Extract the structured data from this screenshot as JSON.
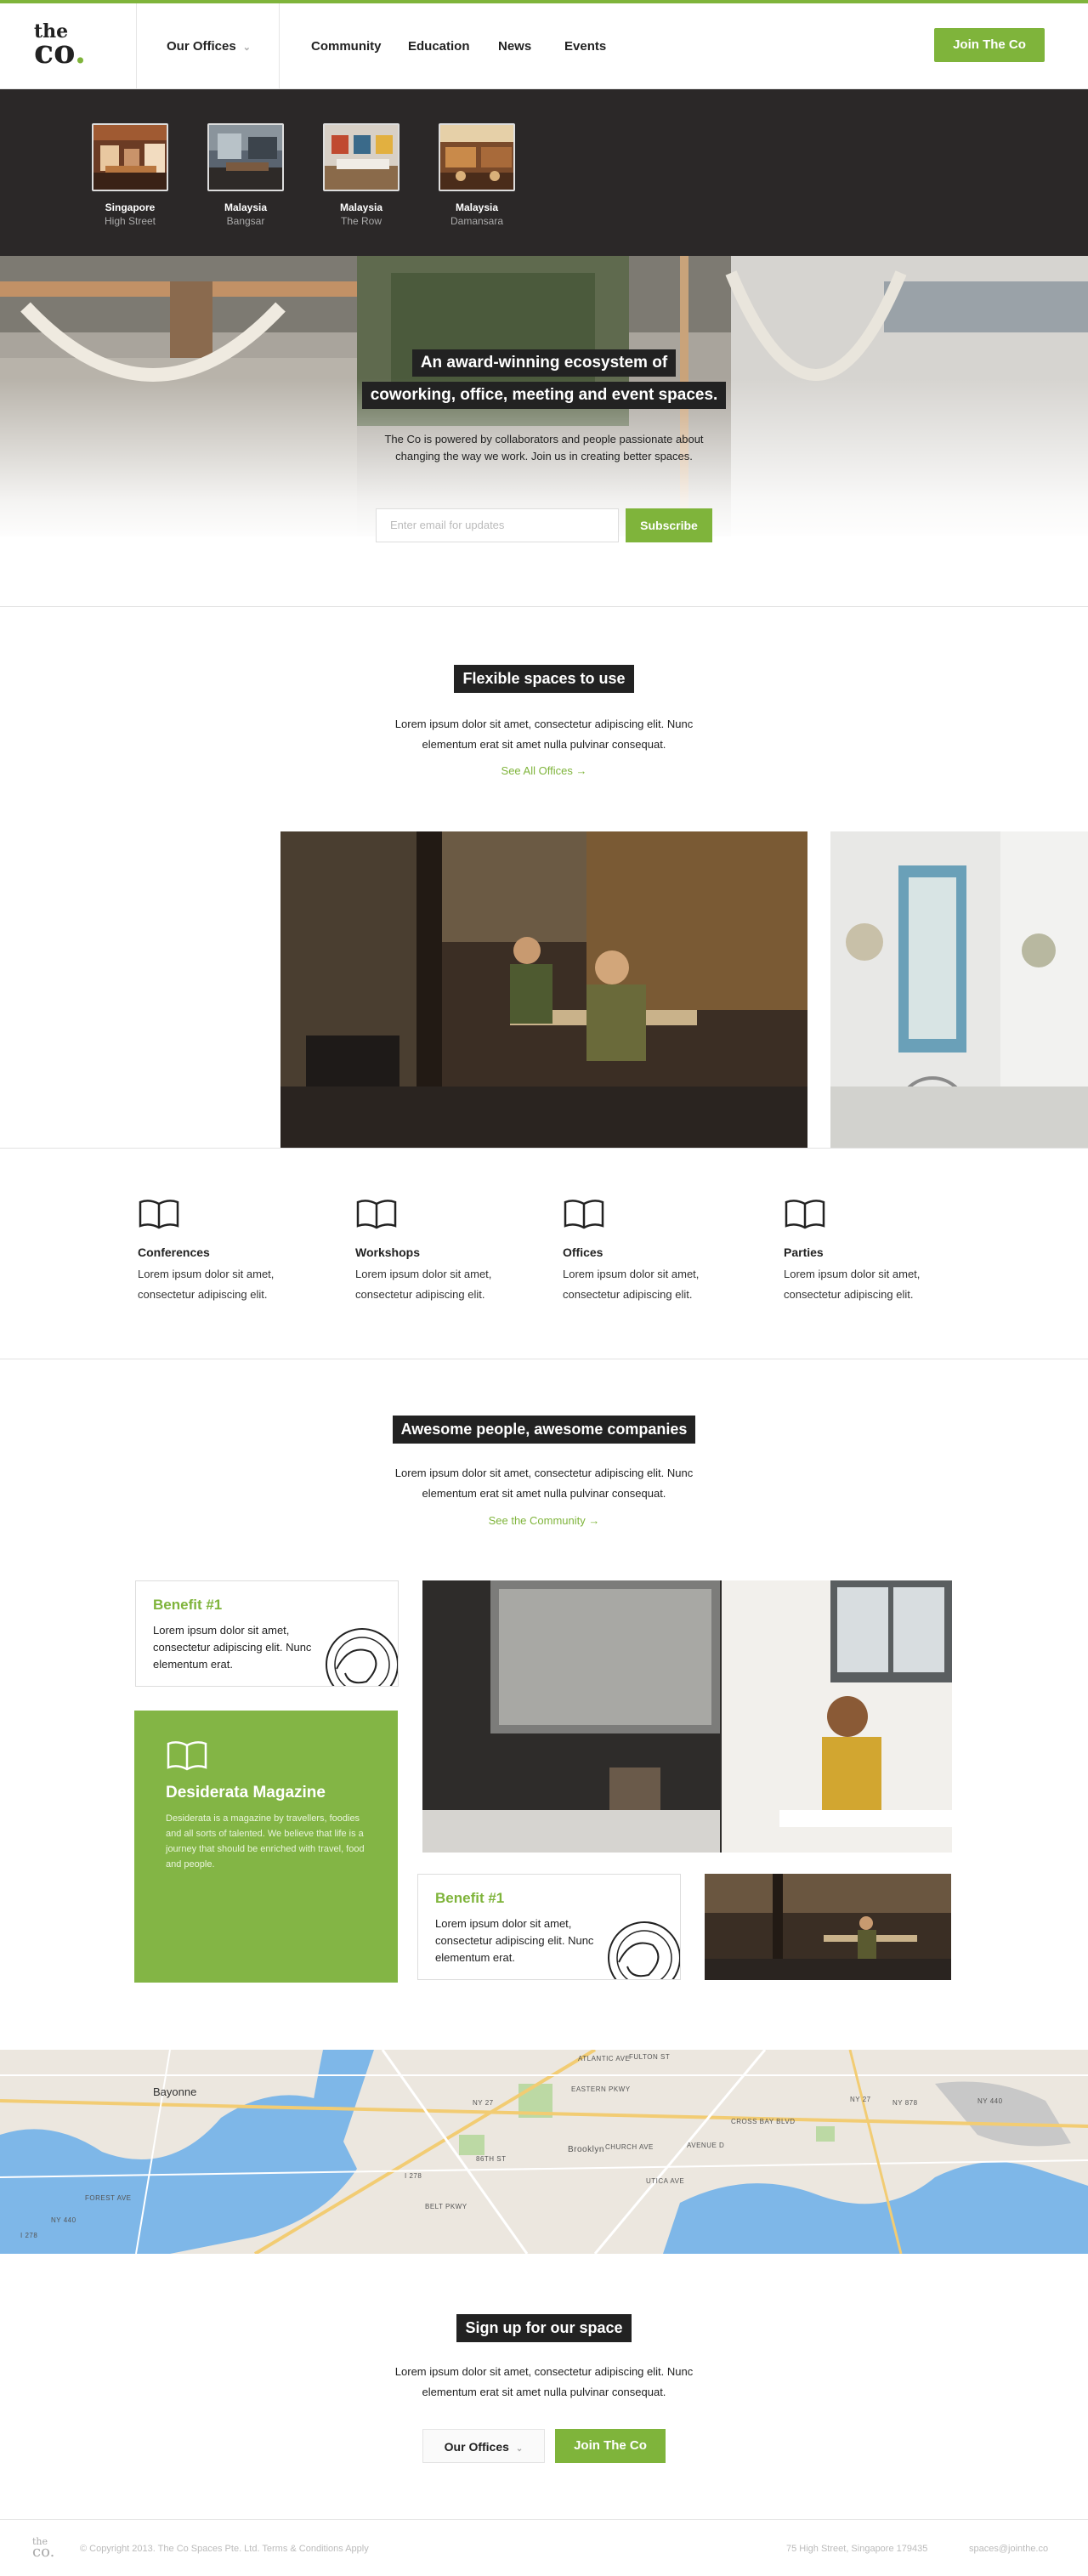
{
  "brand": {
    "logo_top": "the",
    "logo_bottom": "co",
    "accent": "#7fb43b"
  },
  "nav": {
    "offices_label": "Our Offices",
    "items": [
      "Community",
      "Education",
      "News",
      "Events"
    ],
    "join_label": "Join The Co"
  },
  "offices": [
    {
      "country": "Singapore",
      "city": "High Street"
    },
    {
      "country": "Malaysia",
      "city": "Bangsar"
    },
    {
      "country": "Malaysia",
      "city": "The Row"
    },
    {
      "country": "Malaysia",
      "city": "Damansara"
    }
  ],
  "hero": {
    "title_line1": "An award-winning ecosystem of",
    "title_line2": "coworking, office, meeting and event spaces.",
    "subtitle_line1": "The Co is powered by collaborators and people passionate about",
    "subtitle_line2": "changing the way we work. Join us in creating better spaces.",
    "email_placeholder": "Enter email for updates",
    "subscribe_label": "Subscribe"
  },
  "spaces": {
    "title": "Flexible spaces to use",
    "text_line1": "Lorem ipsum dolor sit amet, consectetur adipiscing elit. Nunc",
    "text_line2": "elementum erat sit amet nulla pulvinar consequat.",
    "link": "See All Offices"
  },
  "features": [
    {
      "name": "Conferences",
      "desc": "Lorem ipsum dolor sit amet, consectetur adipiscing elit."
    },
    {
      "name": "Workshops",
      "desc": "Lorem ipsum dolor sit amet, consectetur adipiscing elit."
    },
    {
      "name": "Offices",
      "desc": "Lorem ipsum dolor sit amet, consectetur adipiscing elit."
    },
    {
      "name": "Parties",
      "desc": "Lorem ipsum dolor sit amet, consectetur adipiscing elit."
    }
  ],
  "community": {
    "title": "Awesome people, awesome companies",
    "text_line1": "Lorem ipsum dolor sit amet, consectetur adipiscing elit. Nunc",
    "text_line2": "elementum erat sit amet nulla pulvinar consequat.",
    "link": "See the Community",
    "benefit1_title": "Benefit #1",
    "benefit1_text": "Lorem ipsum dolor sit amet, consectetur adipiscing elit. Nunc elementum erat.",
    "benefit2_title": "Benefit #1",
    "benefit2_text": "Lorem ipsum dolor sit amet, consectetur adipiscing elit. Nunc elementum erat.",
    "magazine_title": "Desiderata Magazine",
    "magazine_text": "Desiderata is a magazine by travellers, foodies and all sorts of talented. We believe that life is a journey that should be enriched with travel, food and people."
  },
  "map": {
    "labels": [
      "Bayonne",
      "ATLANTIC AVE",
      "FULTON ST",
      "EASTERN PKWY",
      "NY 27",
      "NY 27",
      "NY 878",
      "Brooklyn",
      "CHURCH AVE",
      "AVENUE D",
      "FOREST AVE",
      "NY 440",
      "I 278",
      "I 278",
      "BELT PKWY",
      "UTICA AVE",
      "CROSS BAY BLVD",
      "86TH ST",
      "NY 440"
    ]
  },
  "signup": {
    "title": "Sign up for our space",
    "text_line1": "Lorem ipsum dolor sit amet, consectetur adipiscing elit. Nunc",
    "text_line2": "elementum erat sit amet nulla pulvinar consequat.",
    "offices_label": "Our Offices",
    "join_label": "Join The Co"
  },
  "footer": {
    "logo_top": "the",
    "logo_bottom": "co.",
    "copyright": "© Copyright 2013. The Co Spaces Pte. Ltd. Terms & Conditions Apply",
    "address": "75 High Street, Singapore 179435",
    "email": "spaces@jointhe.co"
  }
}
